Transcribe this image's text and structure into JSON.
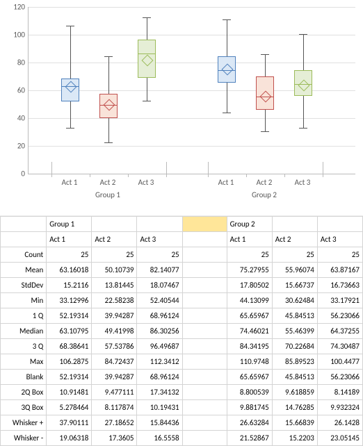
{
  "chart_data": {
    "type": "boxplot",
    "ylim": [
      0,
      120
    ],
    "yticks": [
      0,
      20,
      40,
      60,
      80,
      100,
      120
    ],
    "groups": [
      {
        "name": "Group 1",
        "boxes": [
          {
            "name": "Act 1",
            "min": 33.12996,
            "q1": 52.19314,
            "median": 63.10795,
            "q3": 68.38641,
            "max": 106.2875,
            "mean": 63.16018,
            "color": 1
          },
          {
            "name": "Act 2",
            "min": 22.58238,
            "q1": 39.94287,
            "median": 49.41998,
            "q3": 57.53786,
            "max": 84.72437,
            "mean": 50.10739,
            "color": 2
          },
          {
            "name": "Act 3",
            "min": 52.40544,
            "q1": 68.96124,
            "median": 86.30256,
            "q3": 96.49687,
            "max": 112.3412,
            "mean": 82.14077,
            "color": 3
          }
        ]
      },
      {
        "name": "Group 2",
        "boxes": [
          {
            "name": "Act 1",
            "min": 44.13099,
            "q1": 65.65967,
            "median": 74.46021,
            "q3": 84.34195,
            "max": 110.9748,
            "mean": 75.27955,
            "color": 1
          },
          {
            "name": "Act 2",
            "min": 30.62484,
            "q1": 45.84513,
            "median": 55.46399,
            "q3": 70.22684,
            "max": 85.89523,
            "mean": 55.96074,
            "color": 2
          },
          {
            "name": "Act 3",
            "min": 33.17921,
            "q1": 56.23066,
            "median": 64.37255,
            "q3": 74.30487,
            "max": 100.4477,
            "mean": 63.87167,
            "color": 3
          }
        ]
      }
    ]
  },
  "table": {
    "group_headers": [
      "Group 1",
      "",
      "",
      "",
      "Group 2",
      "",
      ""
    ],
    "col_headers": [
      "Act 1",
      "Act 2",
      "Act 3",
      "",
      "Act 1",
      "Act 2",
      "Act 3"
    ],
    "rows": [
      {
        "label": "Count",
        "cells": [
          "25",
          "25",
          "25",
          "",
          "25",
          "25",
          "25"
        ]
      },
      {
        "label": "Mean",
        "cells": [
          "63.16018",
          "50.10739",
          "82.14077",
          "",
          "75.27955",
          "55.96074",
          "63.87167"
        ]
      },
      {
        "label": "StdDev",
        "cells": [
          "15.2116",
          "13.81445",
          "18.07467",
          "",
          "17.80502",
          "15.66737",
          "16.73663"
        ]
      },
      {
        "label": "Min",
        "cells": [
          "33.12996",
          "22.58238",
          "52.40544",
          "",
          "44.13099",
          "30.62484",
          "33.17921"
        ]
      },
      {
        "label": "1 Q",
        "cells": [
          "52.19314",
          "39.94287",
          "68.96124",
          "",
          "65.65967",
          "45.84513",
          "56.23066"
        ]
      },
      {
        "label": "Median",
        "cells": [
          "63.10795",
          "49.41998",
          "86.30256",
          "",
          "74.46021",
          "55.46399",
          "64.37255"
        ]
      },
      {
        "label": "3 Q",
        "cells": [
          "68.38641",
          "57.53786",
          "96.49687",
          "",
          "84.34195",
          "70.22684",
          "74.30487"
        ]
      },
      {
        "label": "Max",
        "cells": [
          "106.2875",
          "84.72437",
          "112.3412",
          "",
          "110.9748",
          "85.89523",
          "100.4477"
        ]
      },
      {
        "label": "Blank",
        "cells": [
          "52.19314",
          "39.94287",
          "68.96124",
          "",
          "65.65967",
          "45.84513",
          "56.23066"
        ]
      },
      {
        "label": "2Q Box",
        "cells": [
          "10.91481",
          "9.477111",
          "17.34132",
          "",
          "8.800539",
          "9.618859",
          "8.14189"
        ]
      },
      {
        "label": "3Q Box",
        "cells": [
          "5.278464",
          "8.117874",
          "10.19431",
          "",
          "9.881745",
          "14.76285",
          "9.932324"
        ]
      },
      {
        "label": "Whisker +",
        "cells": [
          "37.90111",
          "27.18652",
          "15.84436",
          "",
          "26.63284",
          "15.66839",
          "26.1428"
        ]
      },
      {
        "label": "Whisker -",
        "cells": [
          "19.06318",
          "17.3605",
          "16.5558",
          "",
          "21.52867",
          "15.2203",
          "23.05145"
        ]
      }
    ]
  }
}
